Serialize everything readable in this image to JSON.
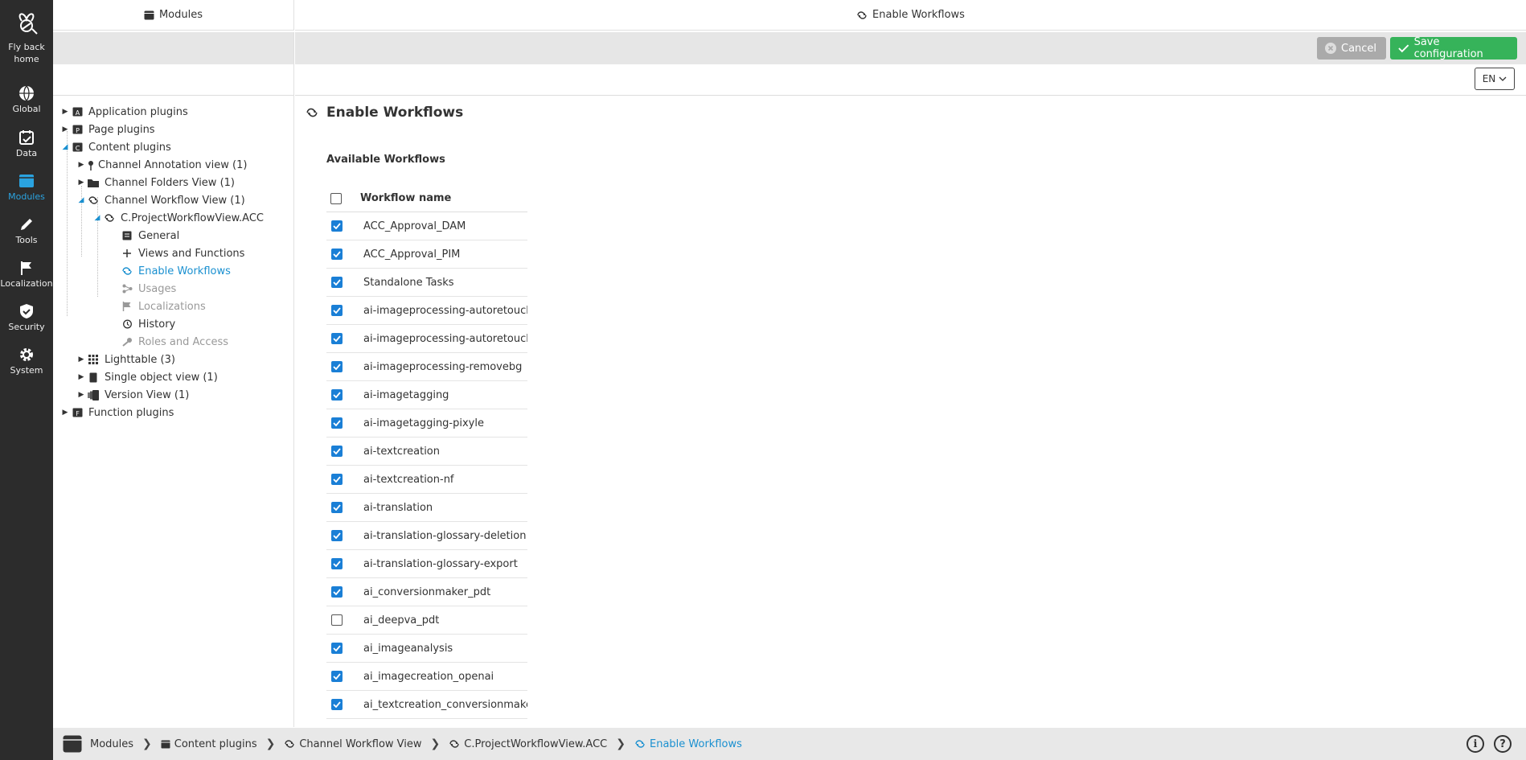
{
  "rail": {
    "items": [
      {
        "label": "Fly back home",
        "icon": "bee-icon"
      },
      {
        "label": "Global",
        "icon": "globe-icon"
      },
      {
        "label": "Data",
        "icon": "calendar-icon"
      },
      {
        "label": "Modules",
        "icon": "module-icon",
        "active": true
      },
      {
        "label": "Tools",
        "icon": "pencil-icon"
      },
      {
        "label": "Localization",
        "icon": "flag-icon"
      },
      {
        "label": "Security",
        "icon": "shield-icon"
      },
      {
        "label": "System",
        "icon": "gear-icon"
      }
    ]
  },
  "tree_panel": {
    "title": "Modules"
  },
  "main_panel": {
    "title": "Enable Workflows"
  },
  "toolbar": {
    "cancel_label": "Cancel",
    "save_label": "Save configuration"
  },
  "lang": {
    "selected": "EN"
  },
  "tree": [
    {
      "label": "Application plugins",
      "state": "collapsed"
    },
    {
      "label": "Page plugins",
      "state": "collapsed"
    },
    {
      "label": "Content plugins",
      "state": "expanded"
    },
    {
      "label": "Channel Annotation view (1)",
      "state": "collapsed"
    },
    {
      "label": "Channel Folders View (1)",
      "state": "collapsed"
    },
    {
      "label": "Channel Workflow View (1)",
      "state": "expanded"
    },
    {
      "label": "C.ProjectWorkflowView.ACC",
      "state": "expanded"
    },
    {
      "label": "General"
    },
    {
      "label": "Views and Functions"
    },
    {
      "label": "Enable Workflows",
      "selected": true
    },
    {
      "label": "Usages",
      "disabled": true
    },
    {
      "label": "Localizations",
      "disabled": true
    },
    {
      "label": "History"
    },
    {
      "label": "Roles and Access",
      "disabled": true
    },
    {
      "label": "Lighttable (3)",
      "state": "collapsed"
    },
    {
      "label": "Single object view (1)",
      "state": "collapsed"
    },
    {
      "label": "Version View (1)",
      "state": "collapsed"
    },
    {
      "label": "Function plugins",
      "state": "collapsed"
    }
  ],
  "content": {
    "page_title": "Enable Workflows",
    "section_title": "Available Workflows",
    "column_header": "Workflow name",
    "workflows": [
      {
        "name": "ACC_Approval_DAM",
        "checked": true
      },
      {
        "name": "ACC_Approval_PIM",
        "checked": true
      },
      {
        "name": "Standalone Tasks",
        "checked": true
      },
      {
        "name": "ai-imageprocessing-autoretouch",
        "checked": true
      },
      {
        "name": "ai-imageprocessing-autoretouch",
        "checked": true
      },
      {
        "name": "ai-imageprocessing-removebg",
        "checked": true
      },
      {
        "name": "ai-imagetagging",
        "checked": true
      },
      {
        "name": "ai-imagetagging-pixyle",
        "checked": true
      },
      {
        "name": "ai-textcreation",
        "checked": true
      },
      {
        "name": "ai-textcreation-nf",
        "checked": true
      },
      {
        "name": "ai-translation",
        "checked": true
      },
      {
        "name": "ai-translation-glossary-deletion",
        "checked": true
      },
      {
        "name": "ai-translation-glossary-export",
        "checked": true
      },
      {
        "name": "ai_conversionmaker_pdt",
        "checked": true
      },
      {
        "name": "ai_deepva_pdt",
        "checked": false
      },
      {
        "name": "ai_imageanalysis",
        "checked": true
      },
      {
        "name": "ai_imagecreation_openai",
        "checked": true
      },
      {
        "name": "ai_textcreation_conversionmaker",
        "checked": true
      }
    ]
  },
  "breadcrumb": [
    {
      "label": "Modules"
    },
    {
      "label": "Content plugins"
    },
    {
      "label": "Channel Workflow View"
    },
    {
      "label": "C.ProjectWorkflowView.ACC"
    },
    {
      "label": "Enable Workflows",
      "current": true
    }
  ],
  "colors": {
    "accent": "#1a90d0",
    "save": "#36b35a",
    "rail": "#2c2c2c"
  }
}
